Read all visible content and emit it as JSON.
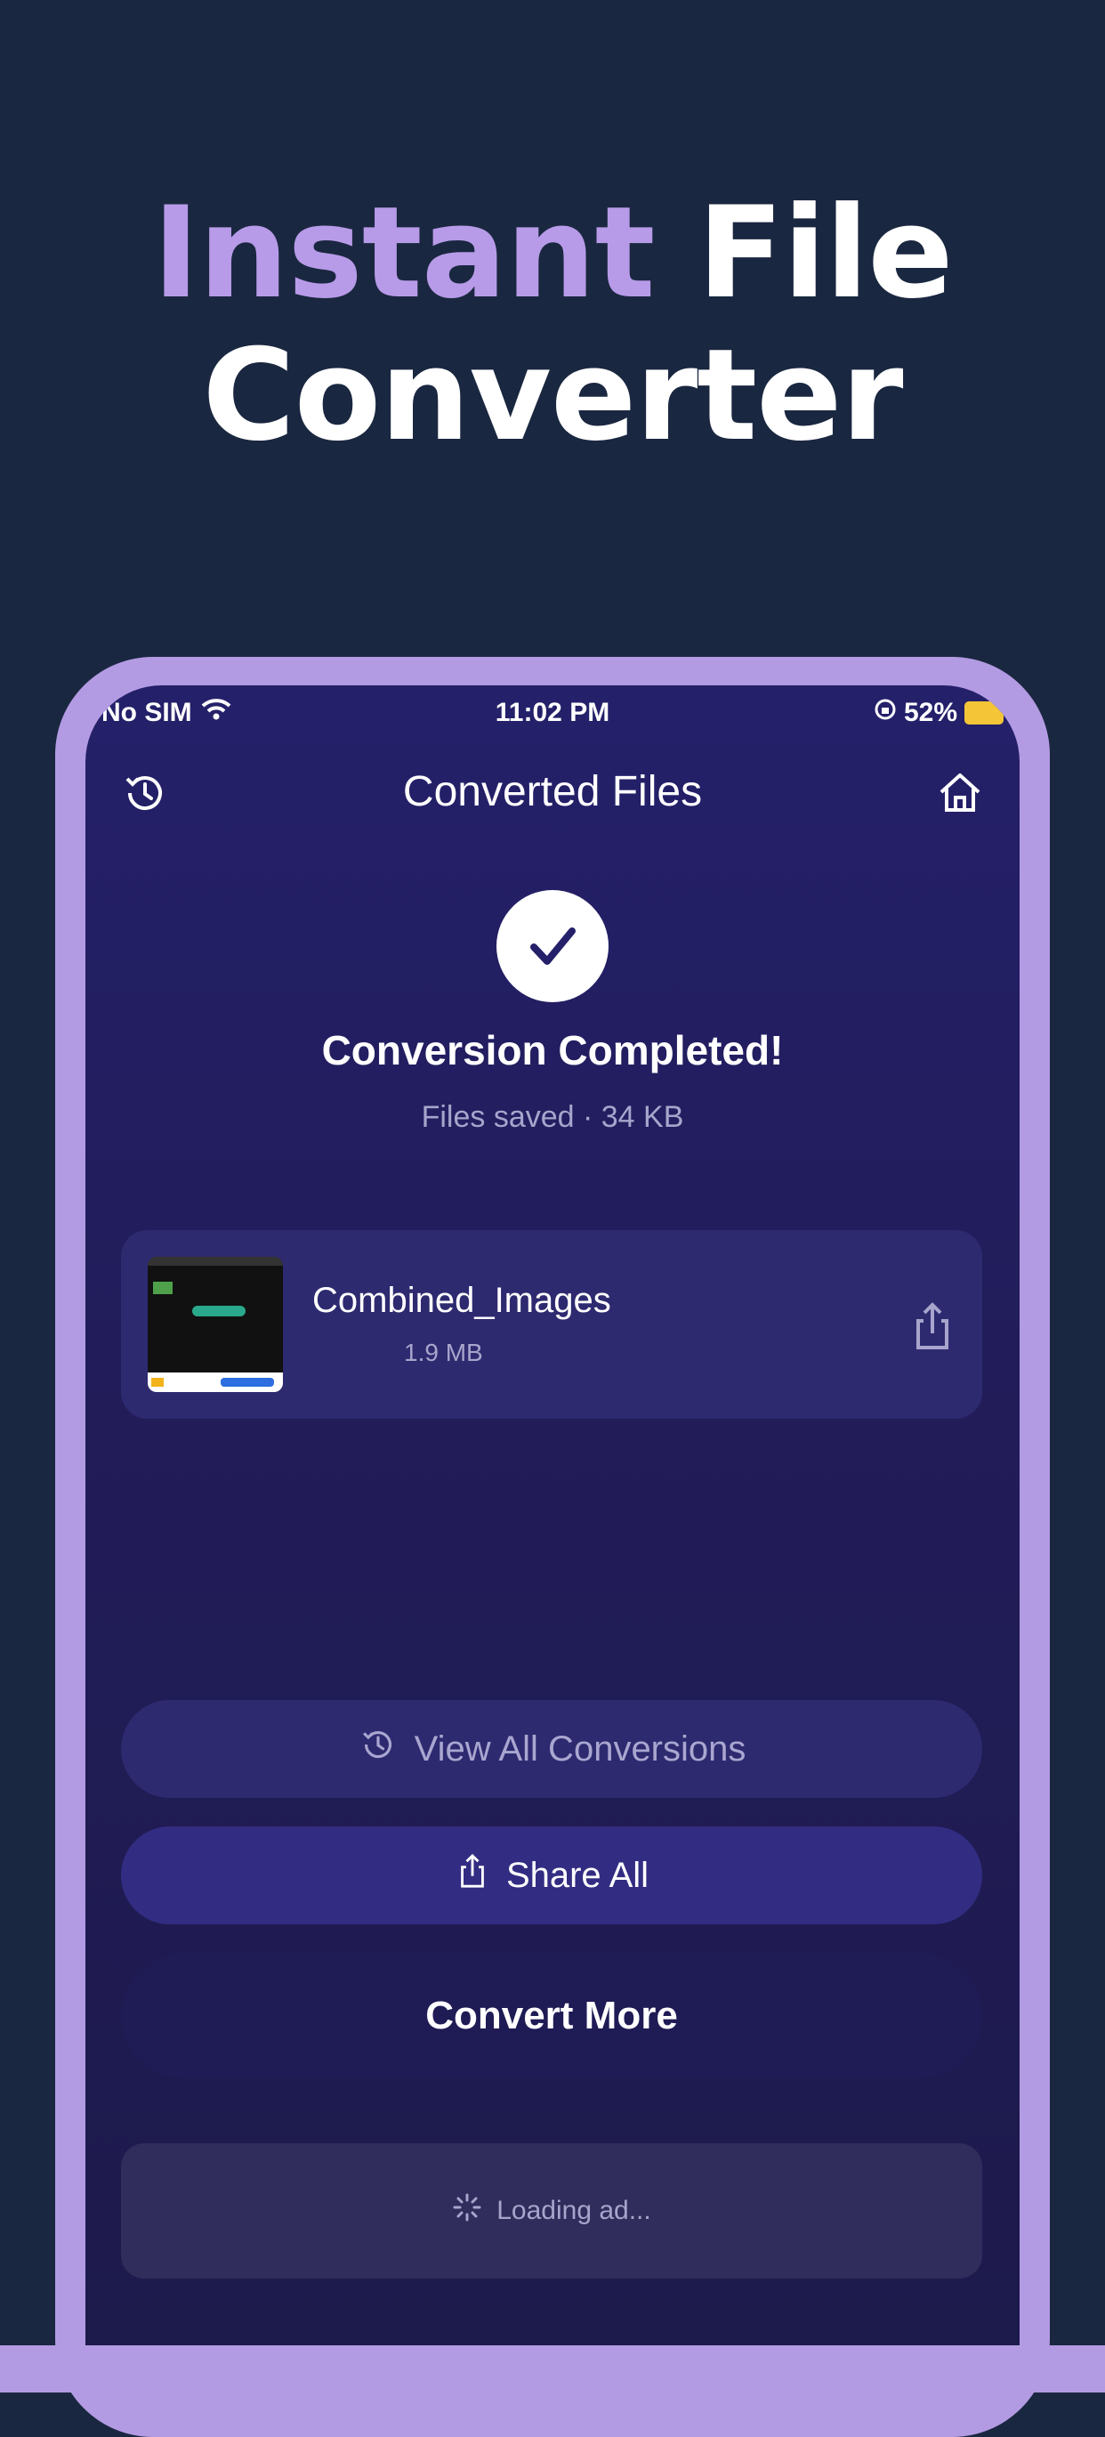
{
  "headline": {
    "accent": "Instant",
    "white_1": "File",
    "white_2": "Converter"
  },
  "status_bar": {
    "carrier": "No SIM",
    "time": "11:02 PM",
    "battery": "52%"
  },
  "nav": {
    "title": "Converted Files",
    "left_icon": "history-icon",
    "right_icon": "home-icon"
  },
  "result": {
    "title": "Conversion Completed!",
    "subtitle": "Files saved · 34 KB"
  },
  "files": [
    {
      "name": "Combined_Images",
      "size": "1.9 MB"
    }
  ],
  "actions": {
    "view_all": "View All Conversions",
    "share_all": "Share All",
    "convert_more": "Convert More"
  },
  "ad": {
    "loading": "Loading ad..."
  },
  "colors": {
    "background": "#1a2740",
    "accent": "#b79be8",
    "screen": "#24206a"
  }
}
